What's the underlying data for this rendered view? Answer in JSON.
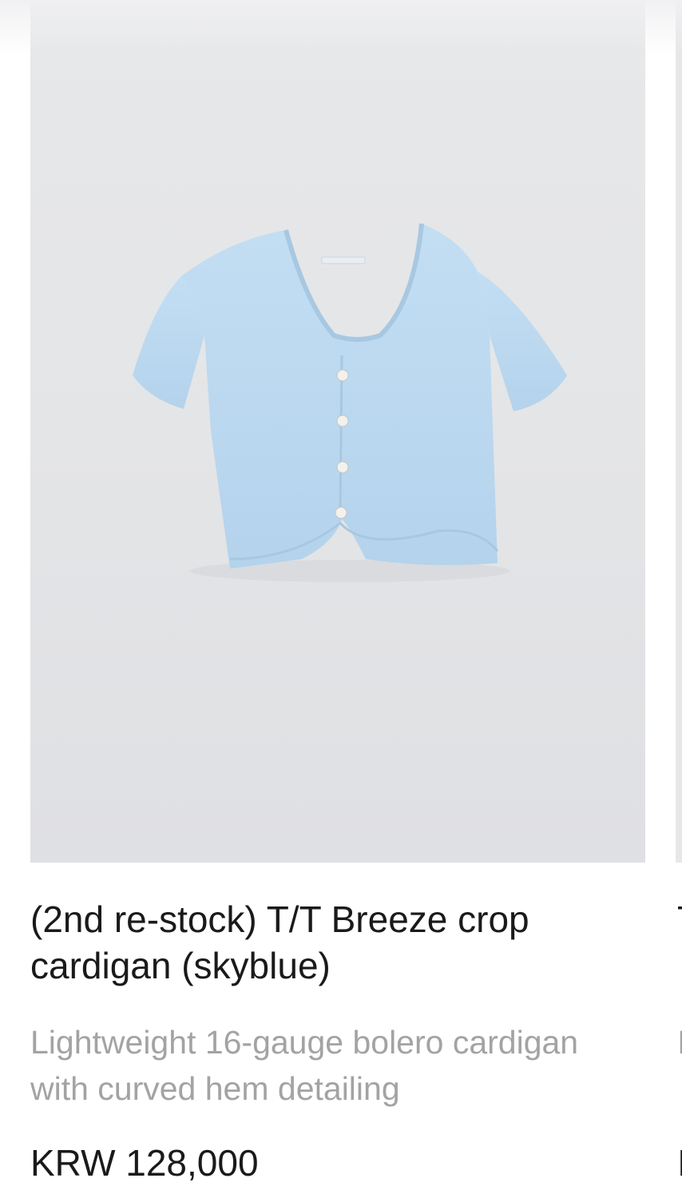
{
  "product": {
    "title": "(2nd re-stock) T/T Breeze crop cardigan (skyblue)",
    "description": "Lightweight 16-gauge bolero cardigan with curved hem detailing",
    "price": "KRW 128,000",
    "image_icon": "cardigan-product-image",
    "garment_color": "#b9d7ef",
    "background_color": "#e5e6e8"
  }
}
